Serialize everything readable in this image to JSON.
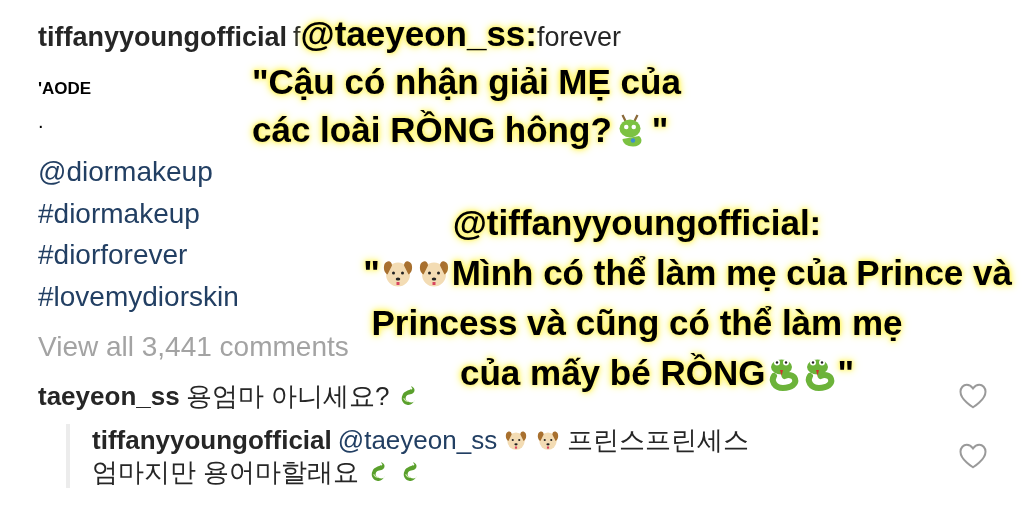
{
  "post": {
    "username": "tiffanyyoungofficial",
    "caption_start": "f",
    "caption_end": "forever",
    "lines": [
      "'AODE",
      "."
    ],
    "tags": [
      "@diormakeup",
      "#diormakeup",
      "#diorforever",
      "#lovemydiorskin"
    ]
  },
  "view_all": "View all 3,441 comments",
  "comments": [
    {
      "username": "taeyeon_ss",
      "text": "용엄마 아니세요?",
      "liked": false,
      "replies": [
        {
          "username": "tiffanyyoungofficial",
          "mention": "@taeyeon_ss",
          "text_1": "프린스프린세스",
          "text_2": "엄마지만 용어마할래요",
          "liked": false
        }
      ]
    }
  ],
  "overlay": {
    "heading_1": "@taeyeon_ss:",
    "lines_1": [
      [
        "\"Cậu có nhận giải MẸ của"
      ],
      [
        "các loài RỒNG hông? ",
        "\""
      ]
    ],
    "heading_2": "@tiffanyyoungofficial:",
    "lines_2": [
      [
        "\"",
        "Mình có thể làm mẹ của Prince và"
      ],
      [
        "Princess và cũng có thể làm mẹ"
      ],
      [
        "của mấy bé RỒNG",
        "\""
      ]
    ]
  }
}
